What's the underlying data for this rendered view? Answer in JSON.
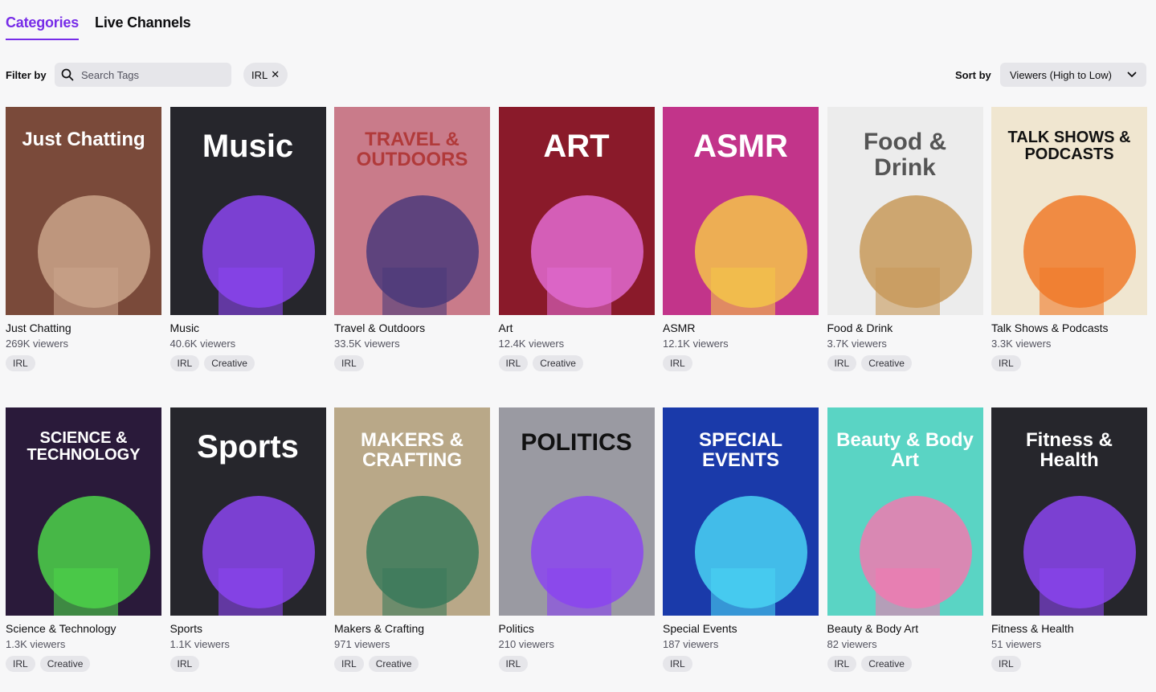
{
  "tabs": [
    {
      "label": "Categories",
      "active": true
    },
    {
      "label": "Live Channels",
      "active": false
    }
  ],
  "filter": {
    "label": "Filter by",
    "search_placeholder": "Search Tags",
    "active_tag": "IRL",
    "remove_glyph": "✕"
  },
  "sort": {
    "label": "Sort by",
    "selected": "Viewers (High to Low)"
  },
  "colors": {
    "accent": "#772ce8",
    "tag_bg": "#e6e6ea"
  },
  "categories": [
    {
      "name": "Just Chatting",
      "viewers": "269K viewers",
      "tags": [
        "IRL"
      ],
      "art": "Just Chatting",
      "bg": "#7a4a3a",
      "fg": "#ffffff",
      "accent": "#caa38a"
    },
    {
      "name": "Music",
      "viewers": "40.6K viewers",
      "tags": [
        "IRL",
        "Creative"
      ],
      "art": "Music",
      "bg": "#26262c",
      "fg": "#ffffff",
      "accent": "#8b45f0"
    },
    {
      "name": "Travel & Outdoors",
      "viewers": "33.5K viewers",
      "tags": [
        "IRL"
      ],
      "art": "TRAVEL & OUTDOORS",
      "bg": "#c97b8a",
      "fg": "#b13a3a",
      "accent": "#4b3a7a"
    },
    {
      "name": "Art",
      "viewers": "12.4K viewers",
      "tags": [
        "IRL",
        "Creative"
      ],
      "art": "ART",
      "bg": "#8a1a2a",
      "fg": "#ffffff",
      "accent": "#e06bd0"
    },
    {
      "name": "ASMR",
      "viewers": "12.1K viewers",
      "tags": [
        "IRL"
      ],
      "art": "ASMR",
      "bg": "#c2348a",
      "fg": "#ffffff",
      "accent": "#f4c44a"
    },
    {
      "name": "Food & Drink",
      "viewers": "3.7K viewers",
      "tags": [
        "IRL",
        "Creative"
      ],
      "art": "Food & Drink",
      "bg": "#ececec",
      "fg": "#555555",
      "accent": "#c89a5a"
    },
    {
      "name": "Talk Shows & Podcasts",
      "viewers": "3.3K viewers",
      "tags": [
        "IRL"
      ],
      "art": "TALK SHOWS & PODCASTS",
      "bg": "#f0e6d0",
      "fg": "#111111",
      "accent": "#f07a2a"
    },
    {
      "name": "Science & Technology",
      "viewers": "1.3K viewers",
      "tags": [
        "IRL",
        "Creative"
      ],
      "art": "SCIENCE & TECHNOLOGY",
      "bg": "#2a1a3a",
      "fg": "#ffffff",
      "accent": "#4cd44a"
    },
    {
      "name": "Sports",
      "viewers": "1.1K viewers",
      "tags": [
        "IRL"
      ],
      "art": "Sports",
      "bg": "#26262c",
      "fg": "#ffffff",
      "accent": "#8b45f0"
    },
    {
      "name": "Makers & Crafting",
      "viewers": "971 viewers",
      "tags": [
        "IRL",
        "Creative"
      ],
      "art": "MAKERS & CRAFTING",
      "bg": "#b9a888",
      "fg": "#ffffff",
      "accent": "#3a7a5a"
    },
    {
      "name": "Politics",
      "viewers": "210 viewers",
      "tags": [
        "IRL"
      ],
      "art": "POLITICS",
      "bg": "#9a9aa2",
      "fg": "#111111",
      "accent": "#8b45f0"
    },
    {
      "name": "Special Events",
      "viewers": "187 viewers",
      "tags": [
        "IRL"
      ],
      "art": "SPECIAL EVENTS",
      "bg": "#1a3aaa",
      "fg": "#ffffff",
      "accent": "#4ad4f4"
    },
    {
      "name": "Beauty & Body Art",
      "viewers": "82 viewers",
      "tags": [
        "IRL",
        "Creative"
      ],
      "art": "Beauty & Body Art",
      "bg": "#5ad4c4",
      "fg": "#ffffff",
      "accent": "#f07ab0"
    },
    {
      "name": "Fitness & Health",
      "viewers": "51 viewers",
      "tags": [
        "IRL"
      ],
      "art": "Fitness & Health",
      "bg": "#26262c",
      "fg": "#ffffff",
      "accent": "#8b45f0"
    }
  ]
}
